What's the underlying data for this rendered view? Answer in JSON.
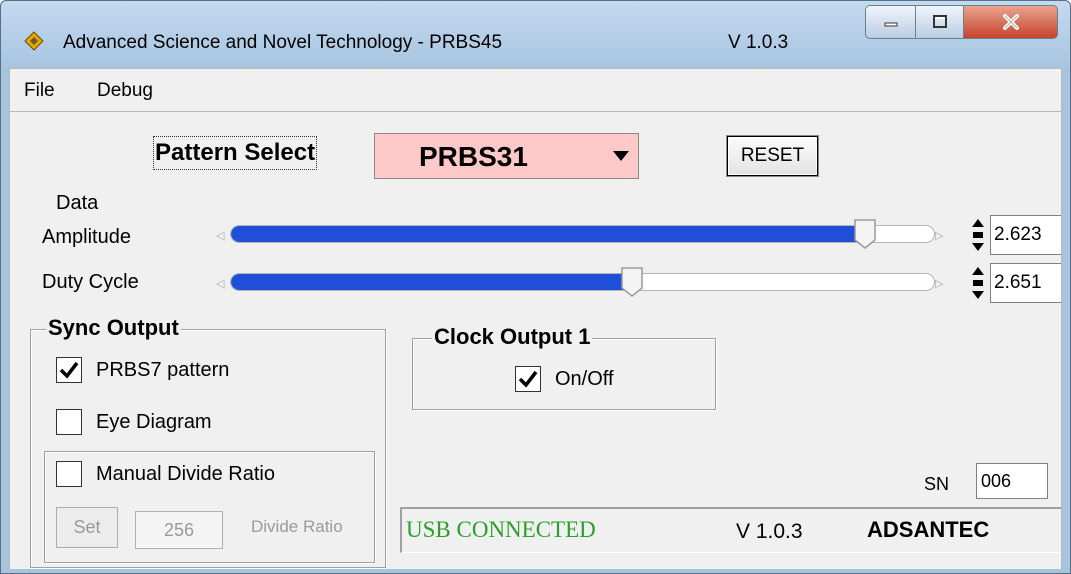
{
  "window": {
    "title": "Advanced Science and Novel Technology - PRBS45",
    "version": "V 1.0.3",
    "controls": {
      "minimize": "minimize",
      "maximize": "maximize",
      "close": "close"
    }
  },
  "menu": {
    "items": [
      "File",
      "Debug"
    ]
  },
  "pattern": {
    "label": "Pattern Select",
    "value": "PRBS31",
    "options_visible": [
      "PRBS31"
    ]
  },
  "reset_label": "RESET",
  "data_amplitude": {
    "label_line1": "Data",
    "label_line2": "Amplitude",
    "value": "2.623",
    "slider_fraction": 0.9
  },
  "duty_cycle": {
    "label": "Duty Cycle",
    "value": "2.651",
    "slider_fraction": 0.57
  },
  "sync_output": {
    "title": "Sync Output",
    "prbs7": {
      "label": "PRBS7 pattern",
      "checked": true
    },
    "eye_diagram": {
      "label": "Eye Diagram",
      "checked": false
    },
    "manual_divide": {
      "label": "Manual Divide Ratio",
      "checked": false
    },
    "set_label": "Set",
    "divide_value": "256",
    "divide_label": "Divide Ratio"
  },
  "clock_output": {
    "title": "Clock Output 1",
    "onoff": {
      "label": "On/Off",
      "checked": true
    }
  },
  "sn": {
    "label": "SN",
    "value": "006"
  },
  "status": {
    "connection": "USB CONNECTED",
    "version": "V 1.0.3",
    "brand": "ADSANTEC"
  },
  "colors": {
    "slider_fill": "#1f4fd8",
    "pattern_bg": "#ffc9c9",
    "status_green": "#2aa02a"
  }
}
